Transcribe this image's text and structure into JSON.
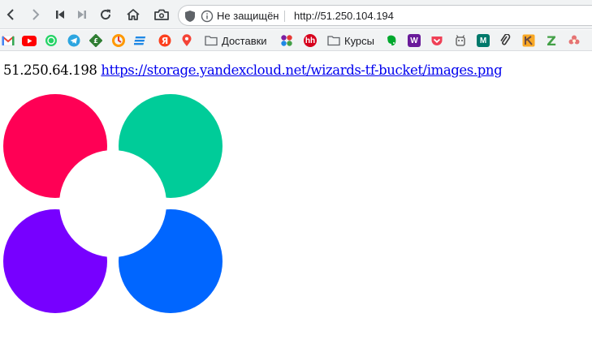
{
  "browser": {
    "security_label": "Не защищён",
    "url": "http://51.250.104.194"
  },
  "bookmarks": [
    {
      "name": "gmail",
      "icon": "gmail-icon",
      "color": "#ea4335"
    },
    {
      "name": "youtube",
      "icon": "youtube-icon",
      "color": "#ff0000"
    },
    {
      "name": "whatsapp",
      "icon": "whatsapp-icon",
      "color": "#25d366"
    },
    {
      "name": "telegram",
      "icon": "telegram-icon",
      "color": "#2ca5e0"
    },
    {
      "name": "green-bookmark",
      "icon": "green-icon",
      "color": "#2e7d32"
    },
    {
      "name": "orange-bookmark",
      "icon": "orange-icon",
      "color": "#ff9800"
    },
    {
      "name": "blue-bookmark",
      "icon": "blue-lines-icon",
      "color": "#1e88e5"
    },
    {
      "name": "yandex",
      "icon": "yandex-icon",
      "color": "#fc3f1d"
    },
    {
      "name": "maps",
      "icon": "map-pin-icon",
      "color": "#f44336"
    },
    {
      "name": "folder-dostavki",
      "icon": "folder-icon",
      "label": "Доставки"
    },
    {
      "name": "colorful-dots",
      "icon": "dots-icon",
      "color": "#7b1fa2"
    },
    {
      "name": "hh",
      "icon": "hh-icon",
      "label_text": "hh",
      "color": "#d6001c"
    },
    {
      "name": "folder-kursy",
      "icon": "folder-icon",
      "label": "Курсы"
    },
    {
      "name": "evernote",
      "icon": "evernote-icon",
      "color": "#00a82d"
    },
    {
      "name": "w-bookmark",
      "icon": "w-icon",
      "label_text": "W",
      "color": "#6a1b9a"
    },
    {
      "name": "pocket",
      "icon": "pocket-icon",
      "color": "#ef4056"
    },
    {
      "name": "mascot-bookmark",
      "icon": "mascot-icon",
      "color": "#555555"
    },
    {
      "name": "m-bookmark",
      "icon": "m-icon",
      "label_text": "M",
      "color": "#00796b"
    },
    {
      "name": "paperclip-bookmark",
      "icon": "paperclip-icon",
      "color": "#333333"
    },
    {
      "name": "k-bookmark",
      "icon": "k-icon",
      "color": "#f9a825"
    },
    {
      "name": "z-bookmark",
      "icon": "z-icon",
      "label_text": "Z",
      "color": "#43a047"
    },
    {
      "name": "flower-bookmark",
      "icon": "flower-icon",
      "color": "#e57373"
    }
  ],
  "page": {
    "ip_text": "51.250.64.198",
    "link_text": "https://storage.yandexcloud.net/wizards-tf-bucket/images.png"
  },
  "logo_colors": {
    "top_left": "#ff0055",
    "top_right": "#00cc99",
    "bottom_left": "#7700ff",
    "bottom_right": "#0066ff"
  }
}
